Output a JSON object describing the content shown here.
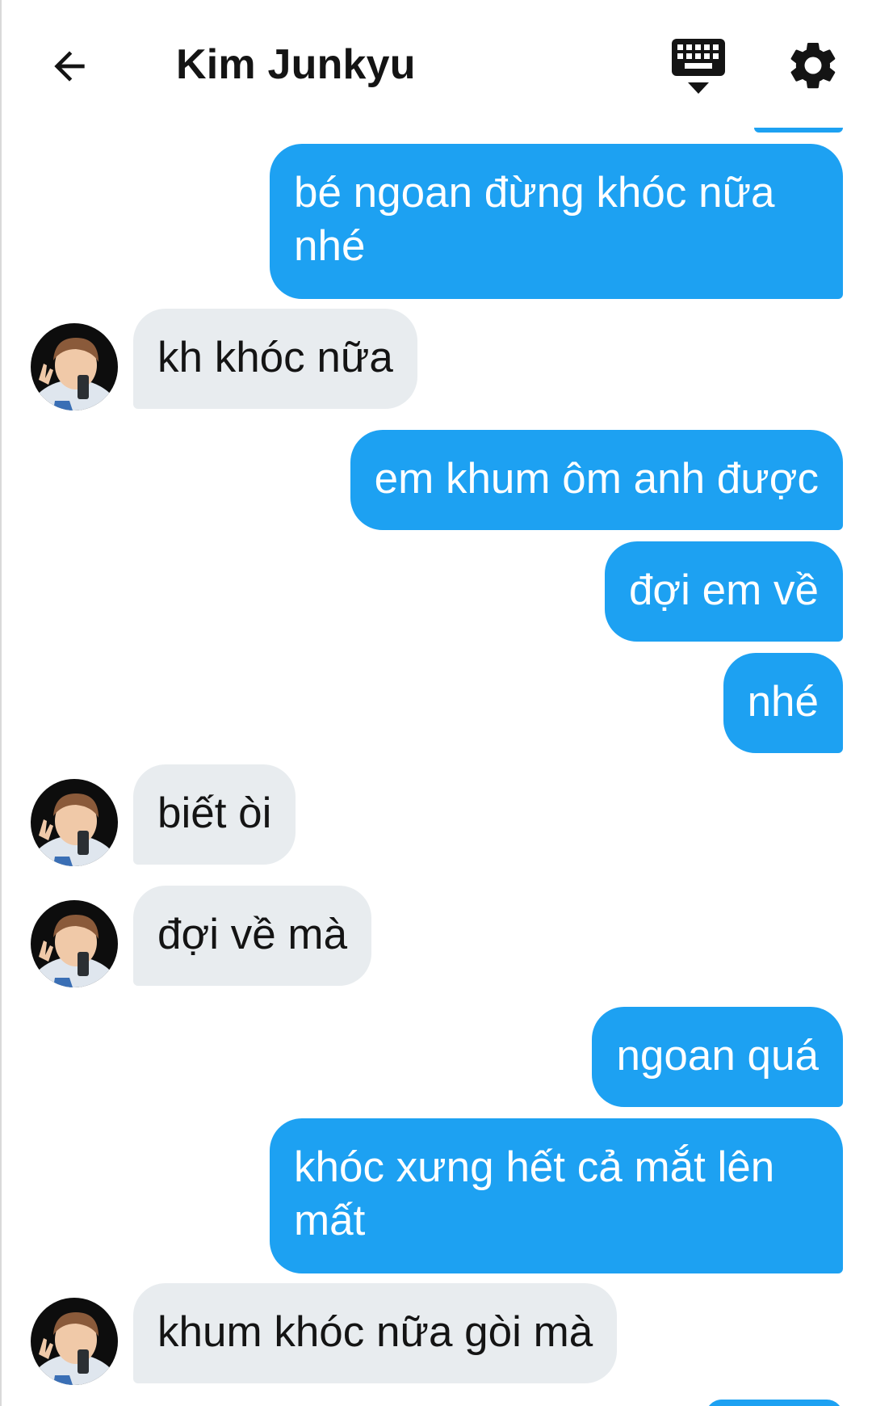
{
  "header": {
    "title": "Kim Junkyu",
    "back_icon": "arrow-left-icon",
    "keyboard_icon": "keyboard-hide-icon",
    "settings_icon": "gear-icon"
  },
  "colors": {
    "outgoing_bubble": "#1da1f2",
    "incoming_bubble": "#e8ecef",
    "text_dark": "#141414"
  },
  "messages": [
    {
      "from": "me",
      "text": "bé ngoan đừng khóc nữa\nnhé"
    },
    {
      "from": "contact",
      "text": "kh khóc nữa"
    },
    {
      "from": "me",
      "text": "em khum ôm anh được"
    },
    {
      "from": "me",
      "text": "đợi em về"
    },
    {
      "from": "me",
      "text": "nhé"
    },
    {
      "from": "contact",
      "text": "biết òi"
    },
    {
      "from": "contact",
      "text": "đợi về mà"
    },
    {
      "from": "me",
      "text": "ngoan quá"
    },
    {
      "from": "me",
      "text": "khóc xưng hết cả mắt lên\nmất"
    },
    {
      "from": "contact",
      "text": "khum khóc nữa gòi mà"
    }
  ]
}
